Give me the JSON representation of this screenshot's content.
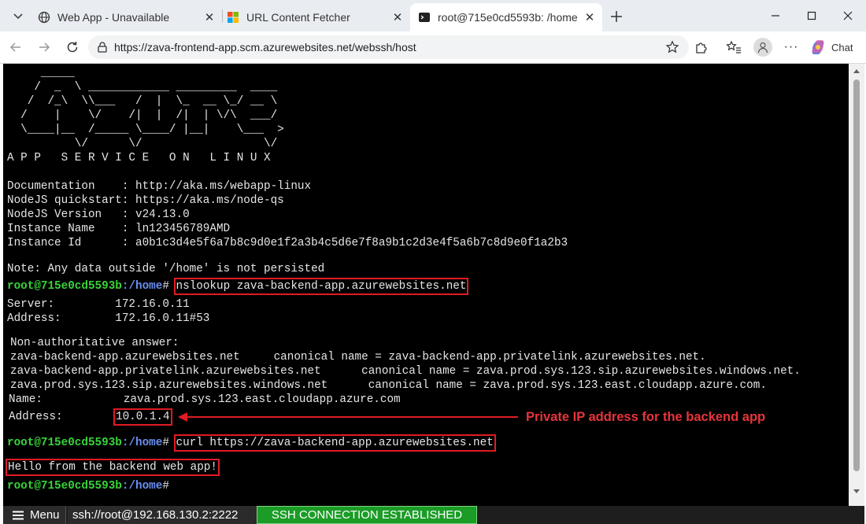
{
  "browser": {
    "tabs": [
      {
        "title": "Web App - Unavailable",
        "icon": "globe-icon",
        "active": false
      },
      {
        "title": "URL Content Fetcher",
        "icon": "windows-logo-icon",
        "active": false
      },
      {
        "title": "root@715e0cd5593b: /home",
        "icon": "terminal-icon",
        "active": true
      }
    ],
    "url": "https://zava-frontend-app.scm.azurewebsites.net/webssh/host",
    "chat_label": "Chat"
  },
  "terminal": {
    "banner_subtitle": "A P P   S E R V I C E   O N   L I N U X",
    "info": [
      "Documentation    : http://aka.ms/webapp-linux",
      "NodeJS quickstart: https://aka.ms/node-qs",
      "NodeJS Version   : v24.13.0",
      "Instance Name    : ln123456789AMD",
      "Instance Id      : a0b1c3d4e5f6a7b8c9d0e1f2a3b4c5d6e7f8a9b1c2d3e4f5a6b7c8d9e0f1a2b3"
    ],
    "note": "Note: Any data outside '/home' is not persisted",
    "prompt_user": "root@715e0cd5593b",
    "prompt_path": ":/home",
    "prompt_symbol": "#",
    "cmd1": "nslookup zava-backend-app.azurewebsites.net",
    "server_line": "Server:         172.16.0.11",
    "address_line": "Address:        172.16.0.11#53",
    "nonauth": "Non-authoritative answer:",
    "cname_lines": [
      "zava-backend-app.azurewebsites.net     canonical name = zava-backend-app.privatelink.azurewebsites.net.",
      "zava-backend-app.privatelink.azurewebsites.net      canonical name = zava.prod.sys.123.sip.azurewebsites.windows.net.",
      "zava.prod.sys.123.sip.azurewebsites.windows.net      canonical name = zava.prod.sys.123.east.cloudapp.azure.com."
    ],
    "name_line": "Name:            zava.prod.sys.123.east.cloudapp.azure.com",
    "addr_label": "Address:",
    "addr_value": "10.0.1.4",
    "annotation": "Private IP address for the backend app",
    "cmd2": "curl https://zava-backend-app.azurewebsites.net",
    "curl_output": "Hello from the backend web app!"
  },
  "statusbar": {
    "menu_label": "Menu",
    "host": "ssh://root@192.168.130.2:2222",
    "connection": "SSH CONNECTION ESTABLISHED"
  },
  "colors": {
    "prompt_user": "#38d43a",
    "prompt_path": "#6b8ef0",
    "highlight": "#e01b24",
    "connection_bg": "#1a9c26"
  }
}
